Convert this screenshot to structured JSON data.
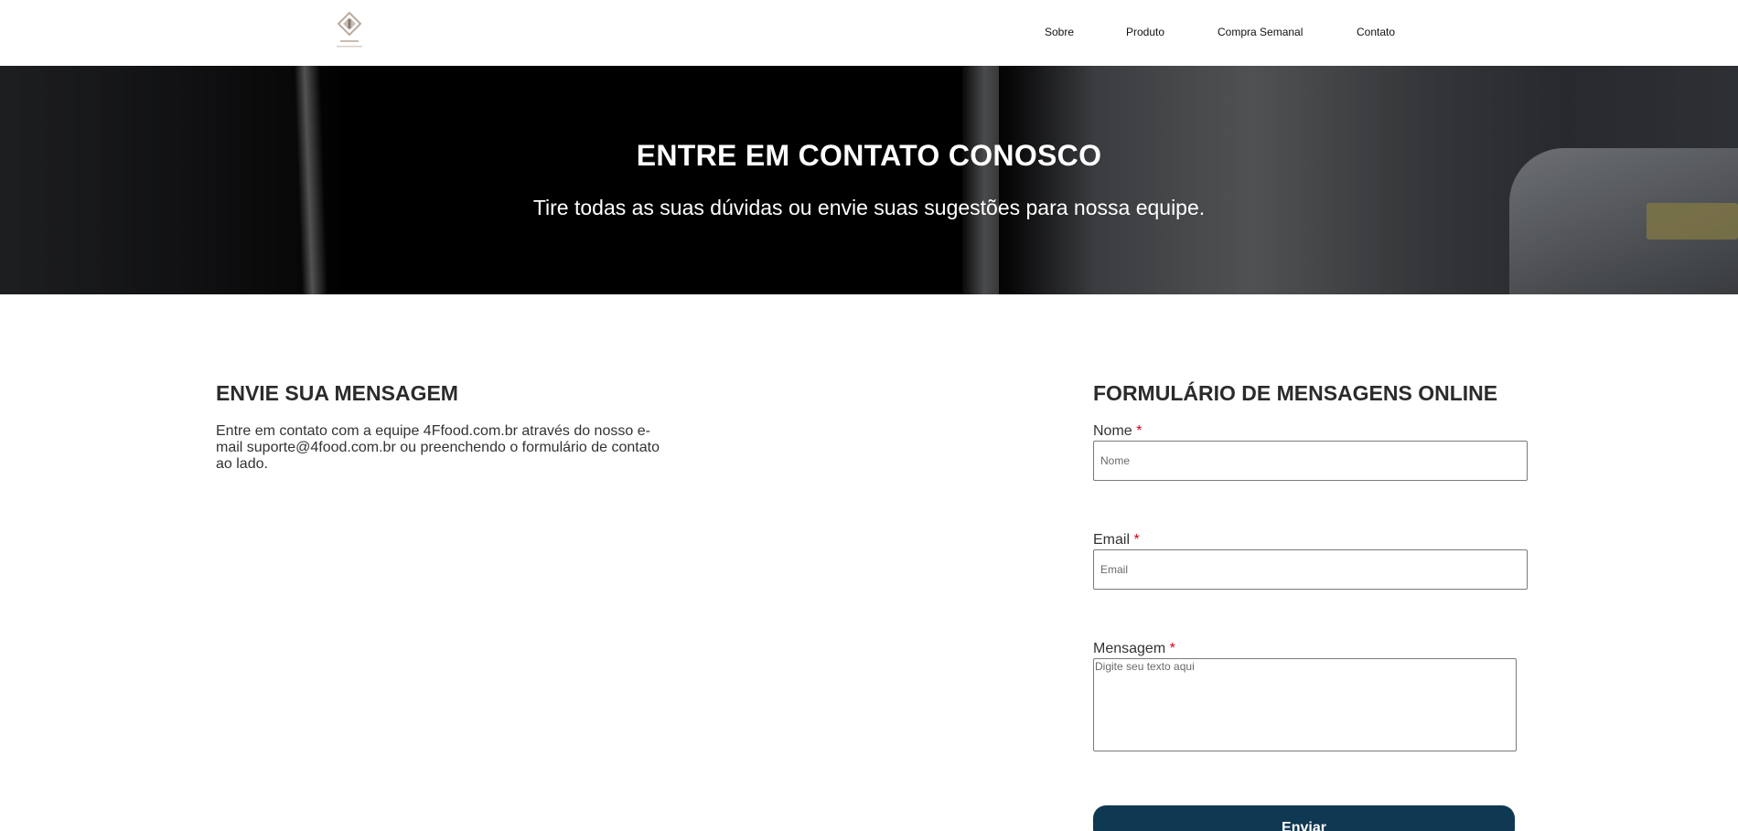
{
  "nav": {
    "items": [
      {
        "label": "Sobre"
      },
      {
        "label": "Produto"
      },
      {
        "label": "Compra Semanal"
      },
      {
        "label": "Contato"
      }
    ]
  },
  "logo": {
    "icon": "diamond-logo-icon",
    "color": "#b9a99e"
  },
  "hero": {
    "title": "ENTRE EM CONTATO CONOSCO",
    "subtitle": "Tire todas as suas dúvidas ou envie suas sugestões para nossa equipe."
  },
  "intro": {
    "title": "ENVIE SUA MENSAGEM",
    "text": "Entre em contato com a equipe 4Ffood.com.br através do nosso e-mail suporte@4food.com.br ou preenchendo o formulário de contato ao lado."
  },
  "form": {
    "title": "FORMULÁRIO DE MENSAGENS ONLINE",
    "required_mark": "*",
    "name": {
      "label": "Nome",
      "placeholder": "Nome",
      "value": ""
    },
    "email": {
      "label": "Email",
      "placeholder": "Email",
      "value": ""
    },
    "message": {
      "label": "Mensagem",
      "placeholder": "Digite seu texto aqui",
      "value": ""
    },
    "submit_label": "Enviar"
  },
  "colors": {
    "button": "#0f3852",
    "required": "#d0021b",
    "hero_text": "#ffffff"
  }
}
